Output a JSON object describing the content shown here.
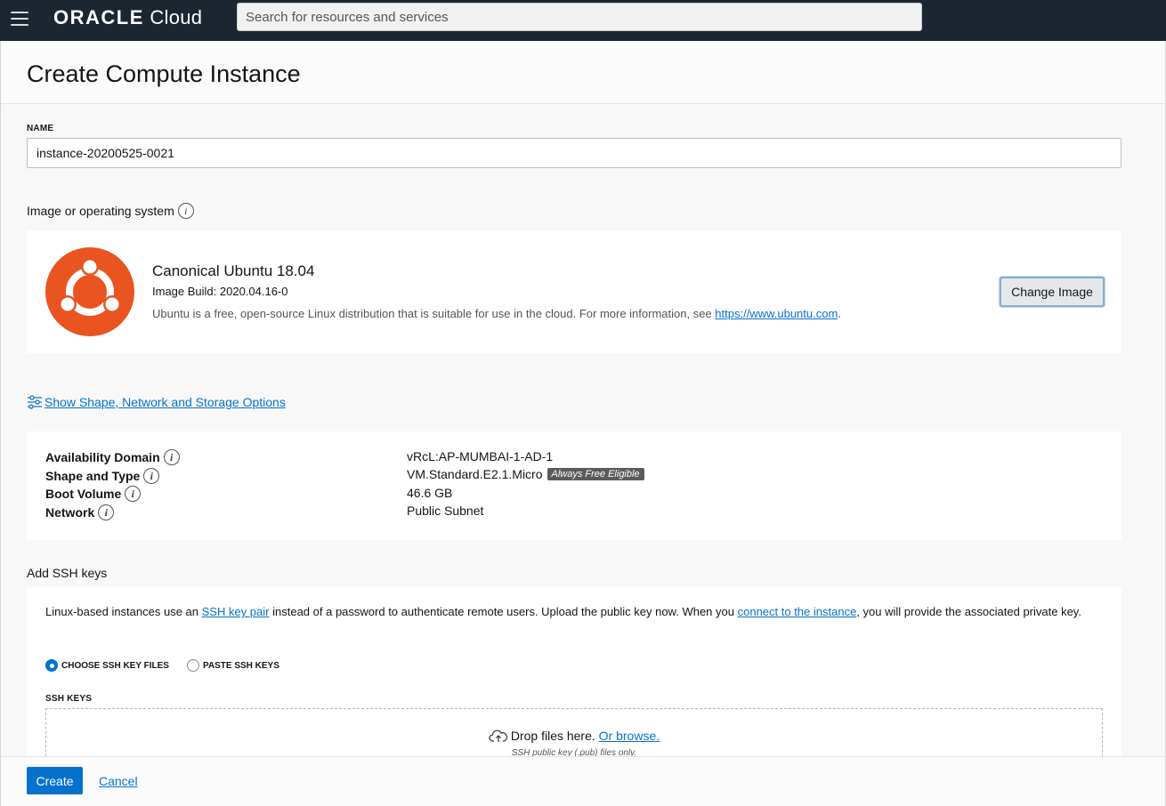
{
  "topbar": {
    "brand_oracle": "ORACLE",
    "brand_cloud": "Cloud",
    "search_placeholder": "Search for resources and services"
  },
  "page": {
    "title": "Create Compute Instance"
  },
  "name_field": {
    "label": "NAME",
    "value": "instance-20200525-0021"
  },
  "image_section": {
    "label": "Image or operating system",
    "image_name": "Canonical Ubuntu 18.04",
    "build": "Image Build: 2020.04.16-0",
    "description": "Ubuntu is a free, open-source Linux distribution that is suitable for use in the cloud. For more information, see ",
    "link": "https://www.ubuntu.com",
    "description_end": ".",
    "change_button": "Change Image",
    "logo_color": "#e95420"
  },
  "options_link": "Show Shape, Network and Storage Options",
  "details": [
    {
      "label": "Availability Domain",
      "value": "vRcL:AP-MUMBAI-1-AD-1",
      "badge": ""
    },
    {
      "label": "Shape and Type",
      "value": "VM.Standard.E2.1.Micro",
      "badge": "Always Free Eligible"
    },
    {
      "label": "Boot Volume",
      "value": "46.6 GB",
      "badge": ""
    },
    {
      "label": "Network",
      "value": "Public Subnet",
      "badge": ""
    }
  ],
  "ssh": {
    "section_label": "Add SSH keys",
    "desc_1": "Linux-based instances use an ",
    "link_1": "SSH key pair",
    "desc_2": " instead of a password to authenticate remote users. Upload the public key now. When you ",
    "link_2": "connect to the instance",
    "desc_3": ", you will provide the associated private key.",
    "option_files": "CHOOSE SSH KEY FILES",
    "option_paste": "PASTE SSH KEYS",
    "keys_label": "SSH KEYS",
    "drop_text": "Drop files here. ",
    "browse_link": "Or browse.",
    "drop_sub": "SSH public key (.pub) files only."
  },
  "footer": {
    "create": "Create",
    "cancel": "Cancel"
  },
  "colors": {
    "topbar": "#1c2630",
    "accent": "#0572ce"
  }
}
